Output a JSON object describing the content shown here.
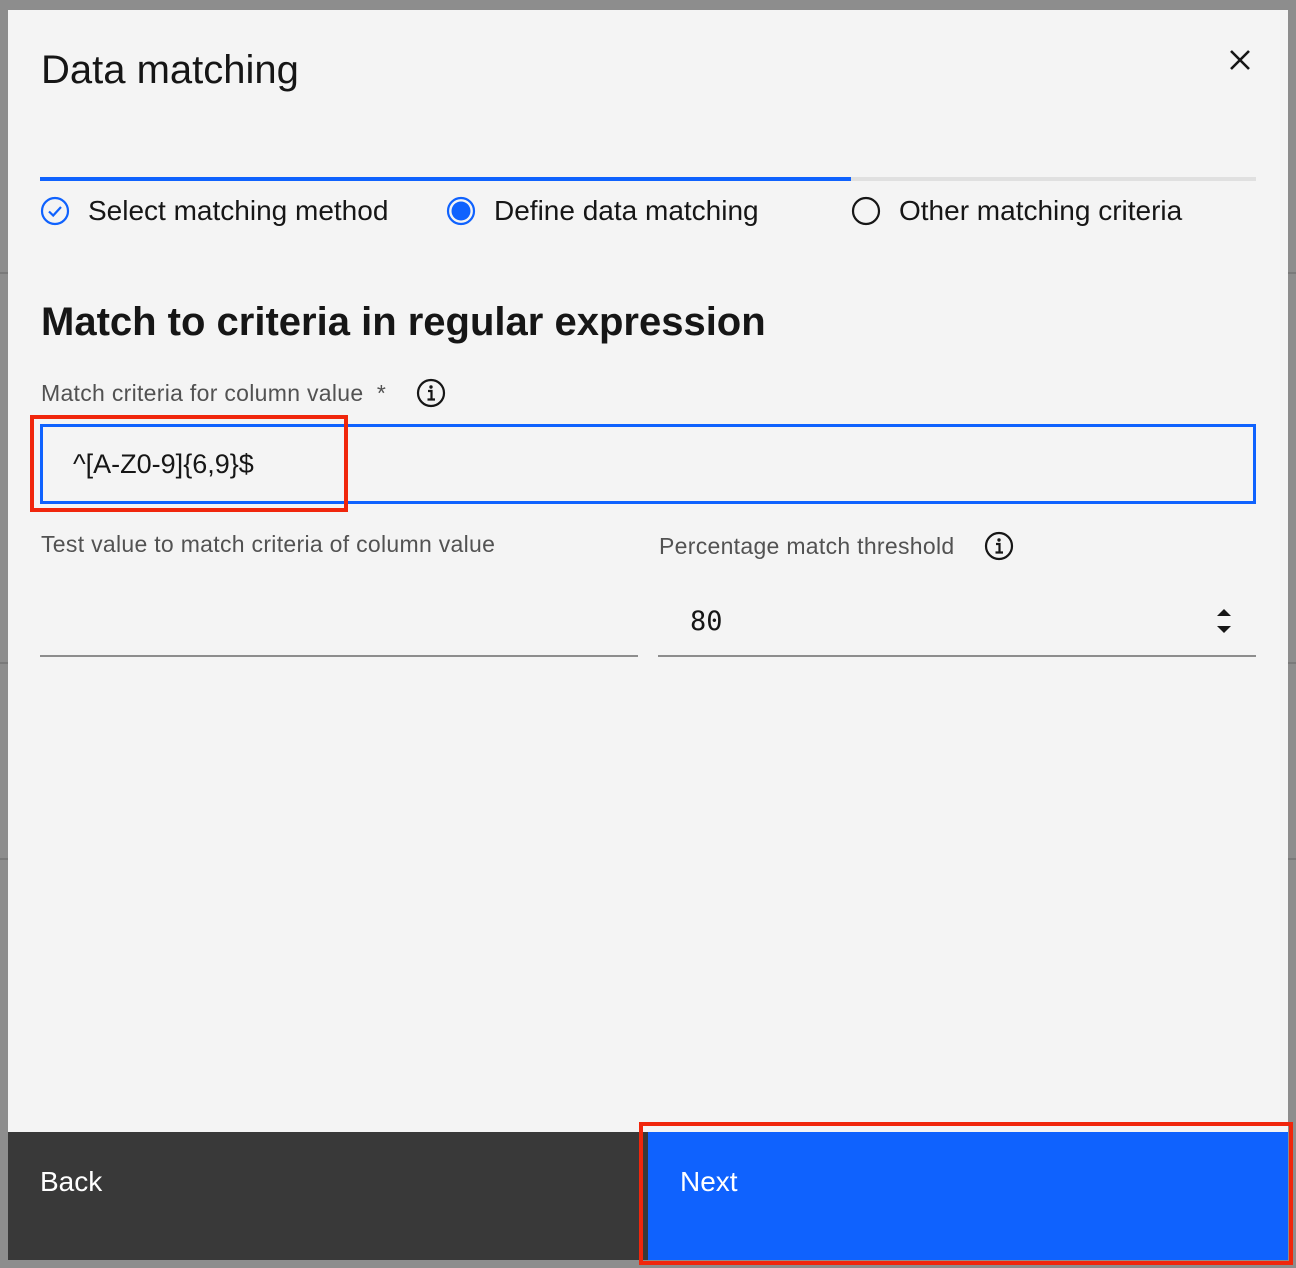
{
  "modal": {
    "title": "Data matching",
    "close_label": "close"
  },
  "progress": {
    "fill_fraction": 0.667,
    "steps": [
      {
        "label": "Select matching method",
        "state": "complete"
      },
      {
        "label": "Define data matching",
        "state": "current"
      },
      {
        "label": "Other matching criteria",
        "state": "incomplete"
      }
    ]
  },
  "section": {
    "title": "Match to criteria in regular expression"
  },
  "fields": {
    "match_criteria": {
      "label": "Match criteria for column value  *",
      "value": "^[A-Z0-9]{6,9}$",
      "info_icon": "info-icon"
    },
    "test_value": {
      "label": "Test value to match criteria of column value",
      "value": ""
    },
    "threshold": {
      "label": "Percentage match threshold",
      "value": "80",
      "info_icon": "info-icon"
    }
  },
  "footer": {
    "back_label": "Back",
    "next_label": "Next"
  },
  "colors": {
    "accent": "#0f62fe",
    "modal_bg": "#f4f4f4",
    "back_button": "#393939",
    "highlight": "#f0260c"
  }
}
